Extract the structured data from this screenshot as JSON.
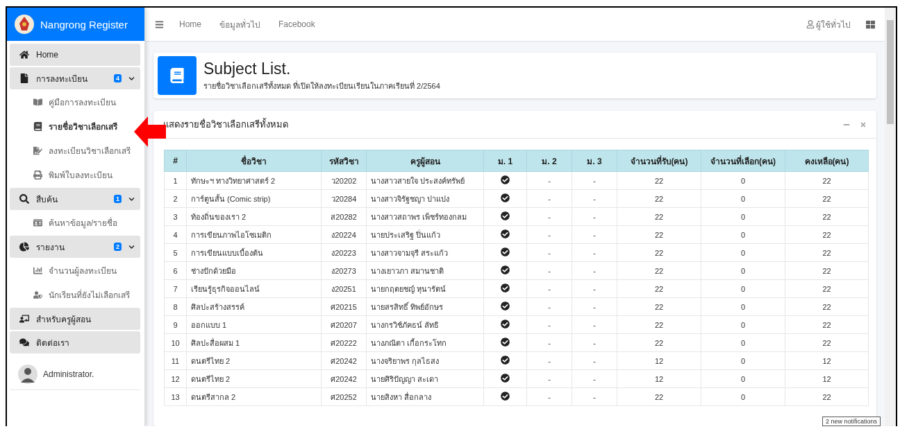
{
  "brand": {
    "title": "Nangrong Register"
  },
  "navbar": {
    "links": [
      "Home",
      "ข้อมูลทั่วไป",
      "Facebook"
    ],
    "user": "ผู้ใช้ทั่วไป"
  },
  "sidebar": {
    "items": [
      {
        "kind": "group",
        "label": "Home"
      },
      {
        "kind": "group",
        "label": "การลงทะเบียน",
        "badge": "4",
        "expanded": true,
        "children": [
          {
            "label": "คู่มือการลงทะเบียน",
            "selected": false
          },
          {
            "label": "รายชื่อวิชาเลือกเสรี",
            "selected": true
          },
          {
            "label": "ลงทะเบียนวิชาเลือกเสรี",
            "selected": false
          },
          {
            "label": "พิมพ์ใบลงทะเบียน",
            "selected": false
          }
        ]
      },
      {
        "kind": "group",
        "label": "สืบค้น",
        "badge": "1",
        "expanded": true,
        "children": [
          {
            "label": "ค้นหาข้อมูล/รายชื่อ",
            "selected": false
          }
        ]
      },
      {
        "kind": "group",
        "label": "รายงาน",
        "badge": "2",
        "expanded": true,
        "children": [
          {
            "label": "จำนวนผู้ลงทะเบียน",
            "selected": false
          },
          {
            "label": "นักเรียนที่ยังไม่เลือกเสรี",
            "selected": false
          }
        ]
      },
      {
        "kind": "group",
        "label": "สำหรับครูผู้สอน"
      },
      {
        "kind": "group",
        "label": "ติดต่อเรา"
      },
      {
        "kind": "user",
        "label": "Administrator."
      }
    ]
  },
  "page_header": {
    "title": "Subject List.",
    "subtitle": "รายชื่อวิชาเลือกเสรีทั้งหมด ที่เปิดให้ลงทะเบียนเรียนในภาคเรียนที่ 2/2564"
  },
  "card": {
    "title": "แสดงรายชื่อวิชาเลือกเสรีทั้งหมด"
  },
  "table": {
    "columns": [
      "#",
      "ชื่อวิชา",
      "รหัสวิชา",
      "ครูผู้สอน",
      "ม. 1",
      "ม. 2",
      "ม. 3",
      "จำนวนที่รับ(คน)",
      "จำนวนที่เลือก(คน)",
      "คงเหลือ(คน)"
    ],
    "rows": [
      {
        "no": "1",
        "name": "ทักษะฯ ทางวิทยาศาสตร์ 2",
        "code": "ว20202",
        "teacher": "นางสาวสายใจ ประสงค์ทรัพย์",
        "m1": true,
        "m2": "-",
        "m3": "-",
        "capacity": "22",
        "chosen": "0",
        "remaining": "22"
      },
      {
        "no": "2",
        "name": "การ์ตูนสั้น (Comic strip)",
        "code": "ว20284",
        "teacher": "นางสาวจิรัฐชญา ปาแปง",
        "m1": true,
        "m2": "-",
        "m3": "-",
        "capacity": "22",
        "chosen": "0",
        "remaining": "22"
      },
      {
        "no": "3",
        "name": "ท้องถิ่นของเรา 2",
        "code": "ส20282",
        "teacher": "นางสาวสถาพร เพ็ชร์ทองกลม",
        "m1": true,
        "m2": "-",
        "m3": "-",
        "capacity": "22",
        "chosen": "0",
        "remaining": "22"
      },
      {
        "no": "4",
        "name": "การเขียนภาพไอโซเมติก",
        "code": "ง20224",
        "teacher": "นายประเสริฐ ปิ่นแก้ว",
        "m1": true,
        "m2": "-",
        "m3": "-",
        "capacity": "22",
        "chosen": "0",
        "remaining": "22"
      },
      {
        "no": "5",
        "name": "การเขียนแบบเบื้องต้น",
        "code": "ง20223",
        "teacher": "นางสาวจามจุรี สระแก้ว",
        "m1": true,
        "m2": "-",
        "m3": "-",
        "capacity": "22",
        "chosen": "0",
        "remaining": "22"
      },
      {
        "no": "6",
        "name": "ช่างปักด้วยมือ",
        "code": "ง20273",
        "teacher": "นางเยาวภา สมานชาติ",
        "m1": true,
        "m2": "-",
        "m3": "-",
        "capacity": "22",
        "chosen": "0",
        "remaining": "22"
      },
      {
        "no": "7",
        "name": "เรียนรู้ธุรกิจออนไลน์",
        "code": "ง20251",
        "teacher": "นายกฤตยชญ์ หุนารัตน์",
        "m1": true,
        "m2": "-",
        "m3": "-",
        "capacity": "22",
        "chosen": "0",
        "remaining": "22"
      },
      {
        "no": "8",
        "name": "ศิลปะสร้างสรรค์",
        "code": "ศ20215",
        "teacher": "นายสรสิทธิ์ ทิพย์อักษร",
        "m1": true,
        "m2": "-",
        "m3": "-",
        "capacity": "22",
        "chosen": "0",
        "remaining": "22"
      },
      {
        "no": "9",
        "name": "ออกแบบ 1",
        "code": "ศ20207",
        "teacher": "นางกรวิช์ภัคธน์ ลัทธิ",
        "m1": true,
        "m2": "-",
        "m3": "-",
        "capacity": "22",
        "chosen": "0",
        "remaining": "22"
      },
      {
        "no": "10",
        "name": "ศิลปะสื่อผสม 1",
        "code": "ศ20222",
        "teacher": "นางภณิตา เกื้อกระโทก",
        "m1": true,
        "m2": "-",
        "m3": "-",
        "capacity": "22",
        "chosen": "0",
        "remaining": "22"
      },
      {
        "no": "11",
        "name": "ดนตรีไทย 2",
        "code": "ศ20242",
        "teacher": "นางจริยาพร กุลไธสง",
        "m1": true,
        "m2": "-",
        "m3": "-",
        "capacity": "12",
        "chosen": "0",
        "remaining": "12"
      },
      {
        "no": "12",
        "name": "ดนตรีไทย 2",
        "code": "ศ20242",
        "teacher": "นายศิริปัญญา สะเดา",
        "m1": true,
        "m2": "-",
        "m3": "-",
        "capacity": "12",
        "chosen": "0",
        "remaining": "12"
      },
      {
        "no": "13",
        "name": "ดนตรีสากล 2",
        "code": "ศ20252",
        "teacher": "นายสิงหา สื่อกลาง",
        "m1": true,
        "m2": "-",
        "m3": "-",
        "capacity": "22",
        "chosen": "0",
        "remaining": "22"
      }
    ]
  },
  "notification": "2 new notifications"
}
